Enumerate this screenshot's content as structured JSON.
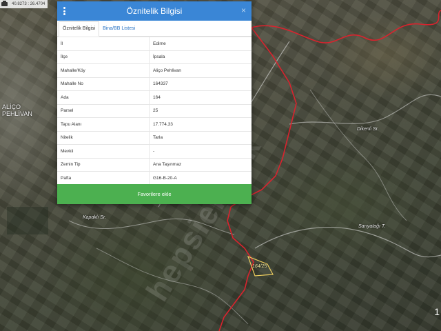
{
  "map": {
    "coordinates": "40.8273 : 26.4704",
    "labels": {
      "village": "ALİÇO\nPEHLİVAN",
      "stream1": "Dikenli Sr.",
      "stream2": "Kapaklı Sr.",
      "stream3": "Sarıyatağı T.",
      "parcel": "164/25"
    },
    "watermark": "hepsiemlak",
    "corner_mark": "1"
  },
  "dialog": {
    "title": "Öznitelik Bilgisi",
    "close_symbol": "×",
    "tabs": [
      {
        "label": "Öznitelik Bilgisi",
        "active": true
      },
      {
        "label": "Bina/BB Listesi",
        "active": false
      }
    ],
    "rows": [
      {
        "key": "İl",
        "value": "Edirne"
      },
      {
        "key": "İlçe",
        "value": "İpsala"
      },
      {
        "key": "Mahalle/Köy",
        "value": "Aliço Pehlivan"
      },
      {
        "key": "Mahalle No",
        "value": "164337"
      },
      {
        "key": "Ada",
        "value": "164"
      },
      {
        "key": "Parsel",
        "value": "25"
      },
      {
        "key": "Tapu Alanı",
        "value": "17.774,33"
      },
      {
        "key": "Nitelik",
        "value": "Tarla"
      },
      {
        "key": "Mevkii",
        "value": "-"
      },
      {
        "key": "Zemin Tip",
        "value": "Ana Taşınmaz"
      },
      {
        "key": "Pafta",
        "value": "G16-B-20-A"
      }
    ],
    "favorite_button": "Favorilere ekle"
  },
  "colors": {
    "header": "#3a86d6",
    "button": "#4cb050",
    "boundary": "#d9232e",
    "parcel_outline": "#f0d060"
  }
}
